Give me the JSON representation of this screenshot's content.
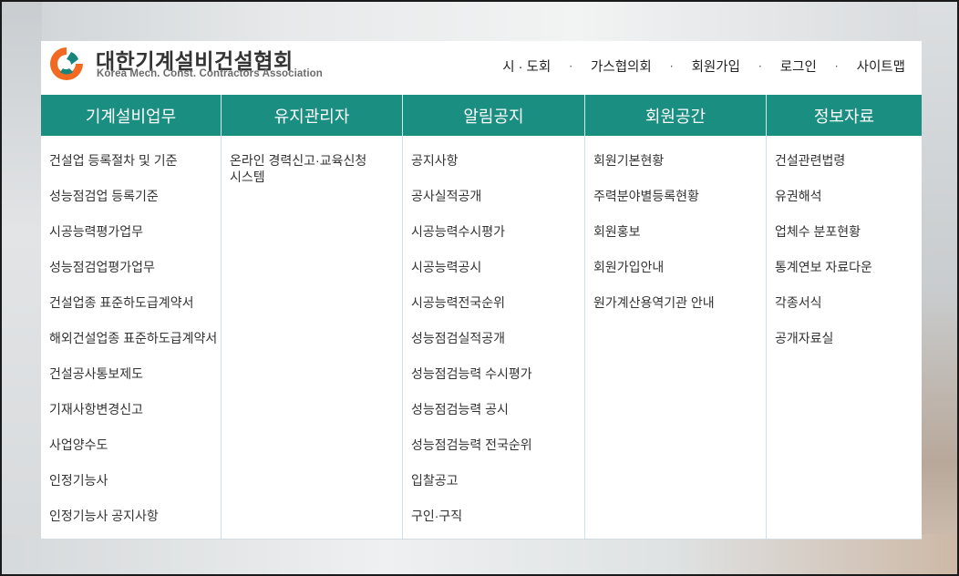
{
  "brand": {
    "name": "대한기계설비건설협회",
    "subtitle": "Korea Mech. Const. Contractors Association",
    "colors": {
      "orange": "#f26a21",
      "teal": "#17857b"
    }
  },
  "util_nav": [
    "시 · 도회",
    "가스협의회",
    "회원가입",
    "로그인",
    "사이트맵"
  ],
  "util_separator": "·",
  "menu": [
    {
      "title": "기계설비업무",
      "items": [
        "건설업 등록절차 및 기준",
        "성능점검업 등록기준",
        "시공능력평가업무",
        "성능점검업평가업무",
        "건설업종 표준하도급계약서",
        "해외건설업종 표준하도급계약서",
        "건설공사통보제도",
        "기재사항변경신고",
        "사업양수도",
        "인정기능사",
        "인정기능사 공지사항"
      ]
    },
    {
      "title": "유지관리자",
      "items": [
        "온라인 경력신고·교육신청 시스템"
      ]
    },
    {
      "title": "알림공지",
      "items": [
        "공지사항",
        "공사실적공개",
        "시공능력수시평가",
        "시공능력공시",
        "시공능력전국순위",
        "성능점검실적공개",
        "성능점검능력 수시평가",
        "성능점검능력 공시",
        "성능점검능력 전국순위",
        "입찰공고",
        "구인·구직"
      ]
    },
    {
      "title": "회원공간",
      "items": [
        "회원기본현황",
        "주력분야별등록현황",
        "회원홍보",
        "회원가입안내",
        "원가계산용역기관 안내"
      ]
    },
    {
      "title": "정보자료",
      "items": [
        "건설관련법령",
        "유권해석",
        "업체수 분포현황",
        "통계연보 자료다운",
        "각종서식",
        "공개자료실"
      ]
    }
  ],
  "theme": {
    "menu_bar": "#1b8e82",
    "column_border": "#cfe0ea"
  }
}
